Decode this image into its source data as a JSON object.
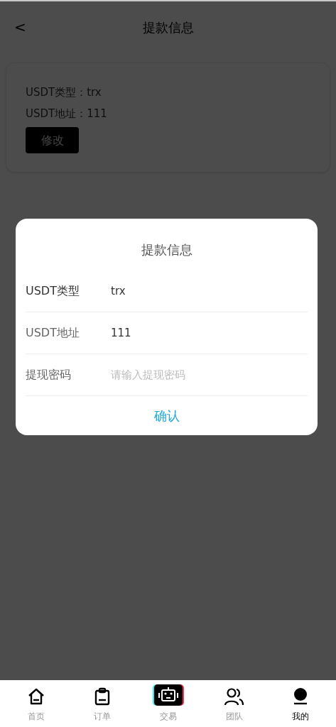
{
  "header": {
    "back": "<",
    "title": "提款信息"
  },
  "card": {
    "lines": [
      {
        "label": "USDT类型：",
        "value": "trx"
      },
      {
        "label": "USDT地址：",
        "value": "111"
      }
    ],
    "button": "修改"
  },
  "dialog": {
    "title": "提款信息",
    "rows": [
      {
        "kind": "picker",
        "label": "USDT类型",
        "value": "trx"
      },
      {
        "kind": "input",
        "label": "USDT地址",
        "value": "111"
      },
      {
        "kind": "input",
        "label": "提现密码",
        "placeholder": "请输入提现密码"
      }
    ],
    "confirm": "确认"
  },
  "tab_bar": [
    {
      "label": "首页",
      "selected": false
    },
    {
      "label": "订单",
      "selected": false
    },
    {
      "label": "交易",
      "selected": false
    },
    {
      "label": "团队",
      "selected": false
    },
    {
      "label": "我的",
      "selected": true
    }
  ]
}
